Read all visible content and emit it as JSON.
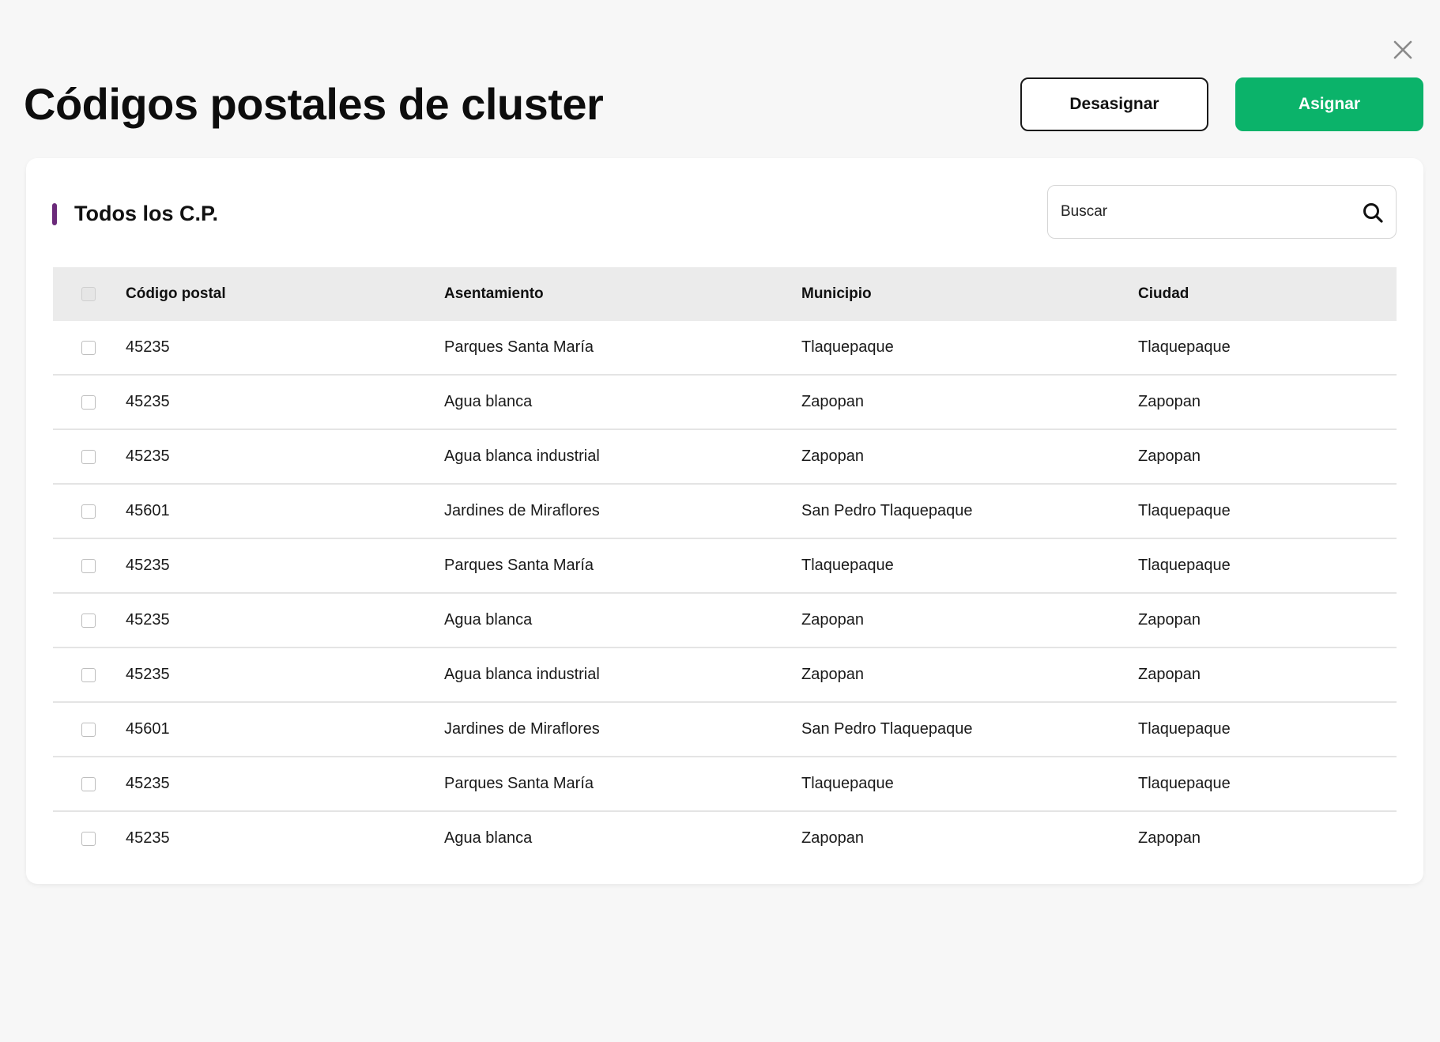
{
  "header": {
    "title": "Códigos postales de cluster",
    "unassign_label": "Desasignar",
    "assign_label": "Asignar",
    "close_icon": "close-icon"
  },
  "colors": {
    "accent_purple": "#6b2a7a",
    "assign_green": "#0bb36a",
    "background": "#f7f7f7"
  },
  "section": {
    "title": "Todos los C.P."
  },
  "search": {
    "placeholder": "Buscar",
    "value": "",
    "icon": "search-icon"
  },
  "table": {
    "columns": [
      "Código postal",
      "Asentamiento",
      "Municipio",
      "Ciudad"
    ],
    "rows": [
      {
        "cp": "45235",
        "asentamiento": "Parques Santa María",
        "municipio": "Tlaquepaque",
        "ciudad": "Tlaquepaque",
        "checked": false
      },
      {
        "cp": "45235",
        "asentamiento": "Agua blanca",
        "municipio": "Zapopan",
        "ciudad": "Zapopan",
        "checked": false
      },
      {
        "cp": "45235",
        "asentamiento": "Agua blanca industrial",
        "municipio": "Zapopan",
        "ciudad": "Zapopan",
        "checked": false
      },
      {
        "cp": "45601",
        "asentamiento": "Jardines de Miraflores",
        "municipio": "San Pedro Tlaquepaque",
        "ciudad": "Tlaquepaque",
        "checked": false
      },
      {
        "cp": "45235",
        "asentamiento": "Parques Santa María",
        "municipio": "Tlaquepaque",
        "ciudad": "Tlaquepaque",
        "checked": false
      },
      {
        "cp": "45235",
        "asentamiento": "Agua blanca",
        "municipio": "Zapopan",
        "ciudad": "Zapopan",
        "checked": false
      },
      {
        "cp": "45235",
        "asentamiento": "Agua blanca industrial",
        "municipio": "Zapopan",
        "ciudad": "Zapopan",
        "checked": false
      },
      {
        "cp": "45601",
        "asentamiento": "Jardines de Miraflores",
        "municipio": "San Pedro Tlaquepaque",
        "ciudad": "Tlaquepaque",
        "checked": false
      },
      {
        "cp": "45235",
        "asentamiento": "Parques Santa María",
        "municipio": "Tlaquepaque",
        "ciudad": "Tlaquepaque",
        "checked": false
      },
      {
        "cp": "45235",
        "asentamiento": "Agua blanca",
        "municipio": "Zapopan",
        "ciudad": "Zapopan",
        "checked": false
      }
    ]
  }
}
